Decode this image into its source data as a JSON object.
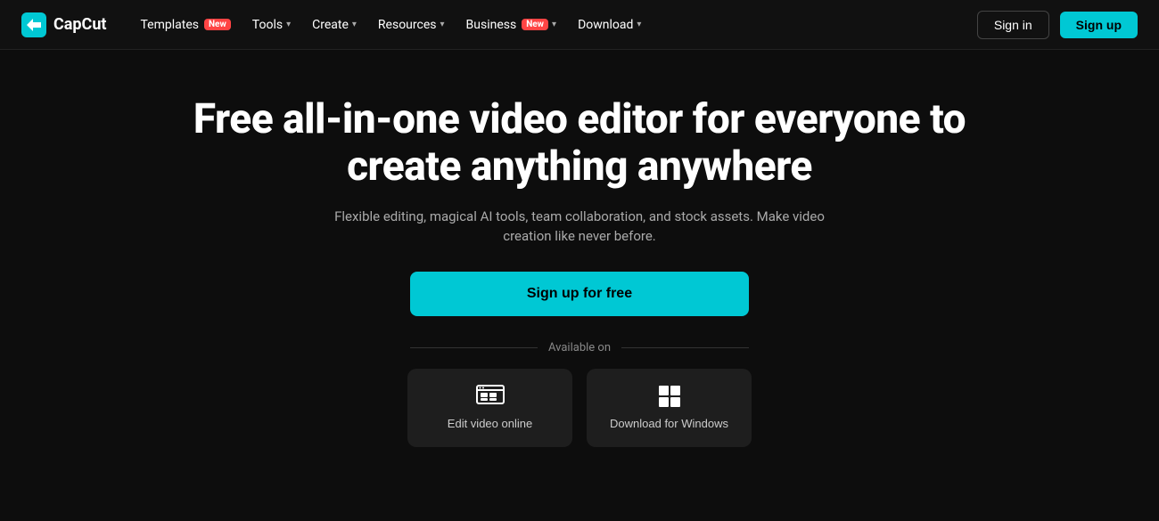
{
  "logo": {
    "text": "CapCut"
  },
  "navbar": {
    "items": [
      {
        "label": "Templates",
        "badge": "New",
        "hasChevron": false
      },
      {
        "label": "Tools",
        "badge": null,
        "hasChevron": true
      },
      {
        "label": "Create",
        "badge": null,
        "hasChevron": true
      },
      {
        "label": "Resources",
        "badge": null,
        "hasChevron": true
      },
      {
        "label": "Business",
        "badge": "New",
        "hasChevron": true
      },
      {
        "label": "Download",
        "badge": null,
        "hasChevron": true
      }
    ],
    "signin_label": "Sign in",
    "signup_label": "Sign up"
  },
  "hero": {
    "title": "Free all-in-one video editor for everyone to create anything anywhere",
    "subtitle": "Flexible editing, magical AI tools, team collaboration, and stock assets. Make video creation like never before.",
    "cta_label": "Sign up for free",
    "available_on_label": "Available on"
  },
  "platforms": [
    {
      "id": "online",
      "label": "Edit video online",
      "icon_type": "monitor"
    },
    {
      "id": "windows",
      "label": "Download for Windows",
      "icon_type": "windows"
    }
  ]
}
